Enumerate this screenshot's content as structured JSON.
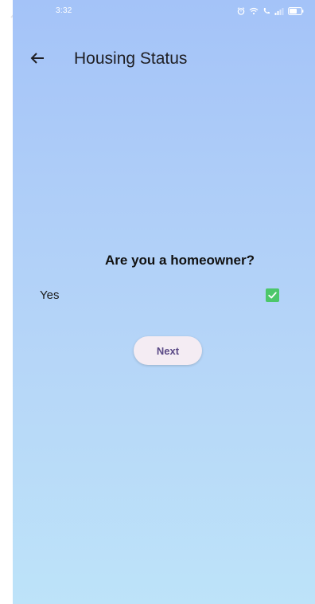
{
  "status_bar": {
    "time": "3:32",
    "icons": [
      "alarm-icon",
      "wifi-icon",
      "call-icon",
      "signal-icon",
      "battery-icon"
    ]
  },
  "app_bar": {
    "back_icon": "arrow-left-icon",
    "title": "Housing Status"
  },
  "form": {
    "question": "Are you a homeowner?",
    "option": {
      "label": "Yes",
      "checked": true
    },
    "next_label": "Next"
  },
  "colors": {
    "background_top": "#a4c3f8",
    "background_bottom": "#bde3f9",
    "checkbox": "#4cc76a",
    "button_bg": "#f4ecf3",
    "button_text": "#5b4a86"
  }
}
